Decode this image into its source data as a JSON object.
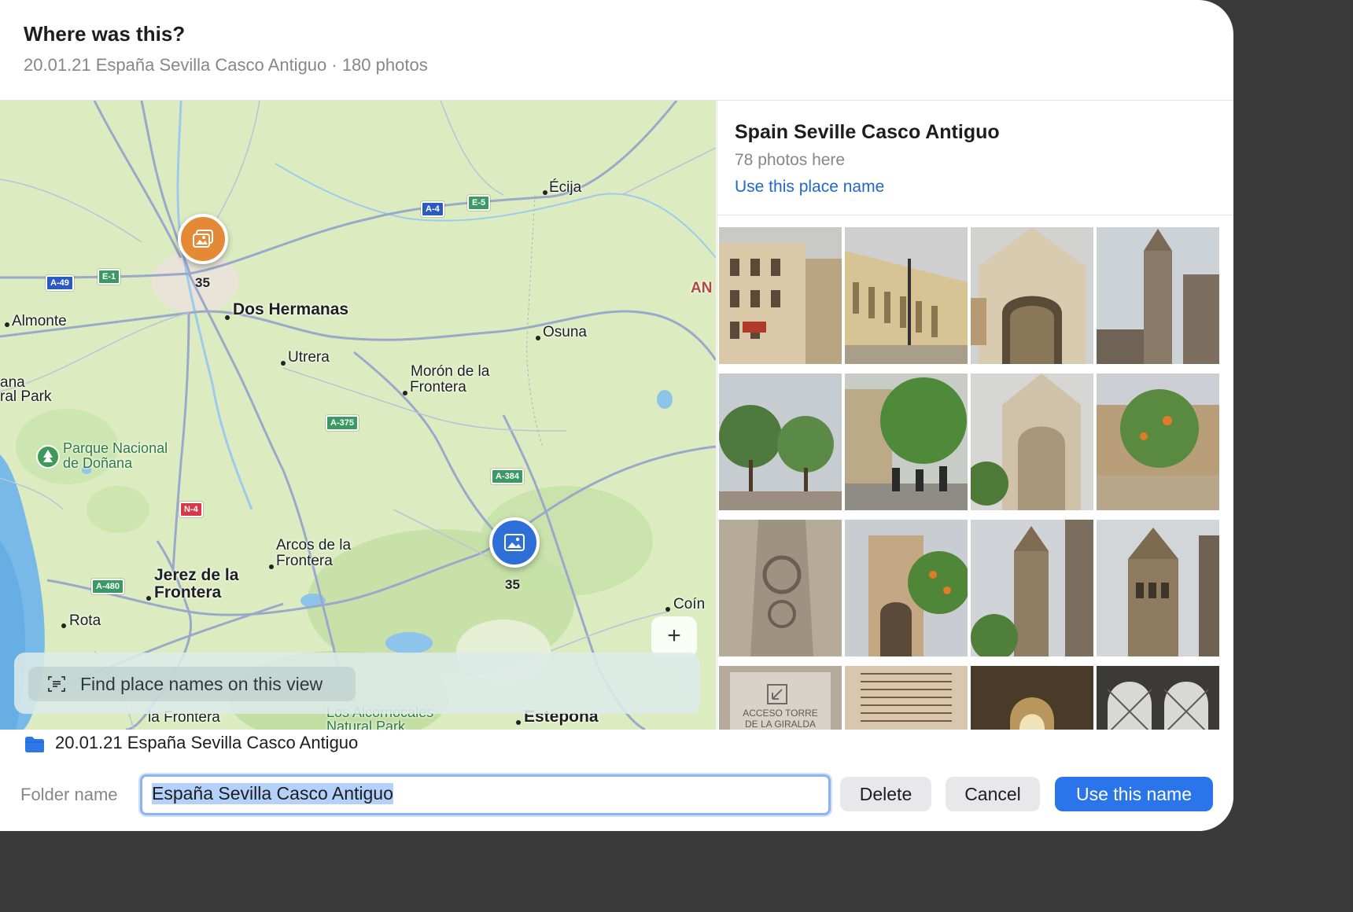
{
  "header": {
    "title": "Where was this?",
    "subtitle": "20.01.21 España Sevilla Casco Antiguo · 180 photos"
  },
  "map": {
    "labels": {
      "ecija": "Écija",
      "dos_hermanas": "Dos Hermanas",
      "almonte": "Almonte",
      "osuna": "Osuna",
      "utrera": "Utrera",
      "moron_1": "Morón de la",
      "moron_2": "Frontera",
      "donana_1": "Parque Nacional",
      "donana_2": "de Doñana",
      "arcos_1": "Arcos de la",
      "arcos_2": "Frontera",
      "jerez_1": "Jerez de la",
      "jerez_2": "Frontera",
      "rota": "Rota",
      "coin": "Coín",
      "estepona": "Estepona",
      "an_edge": "AN",
      "ana_edge": "ana",
      "park_edge": "ral Park",
      "frontera_bottom": "la Frontera",
      "alcornocales_1": "Los Alcornocales",
      "alcornocales_2": "Natural Park"
    },
    "roads": {
      "a4": "A-4",
      "e5": "E-5",
      "a49": "A-49",
      "e1": "E-1",
      "a375": "A-375",
      "a384": "A-384",
      "n4": "N-4",
      "a480": "A-480"
    },
    "pins": {
      "sevilla_count": "35",
      "ronda_count": "35"
    },
    "zoom_in": "+",
    "find_button": "Find place names on this view"
  },
  "place": {
    "name": "Spain Seville Casco Antiguo",
    "count": "78 photos here",
    "link": "Use this place name",
    "sign_text_1": "ACCESO TORRE",
    "sign_text_2": "DE LA GIRALDA"
  },
  "footer": {
    "folder_path": "20.01.21 España Sevilla Casco Antiguo",
    "folder_label": "Folder name",
    "folder_value": "España Sevilla Casco Antiguo",
    "delete": "Delete",
    "cancel": "Cancel",
    "use_name": "Use this name"
  },
  "colors": {
    "accent": "#2a75ea",
    "link": "#2068d1",
    "pin_orange": "#e48a36",
    "pin_blue": "#2d6fd6"
  }
}
